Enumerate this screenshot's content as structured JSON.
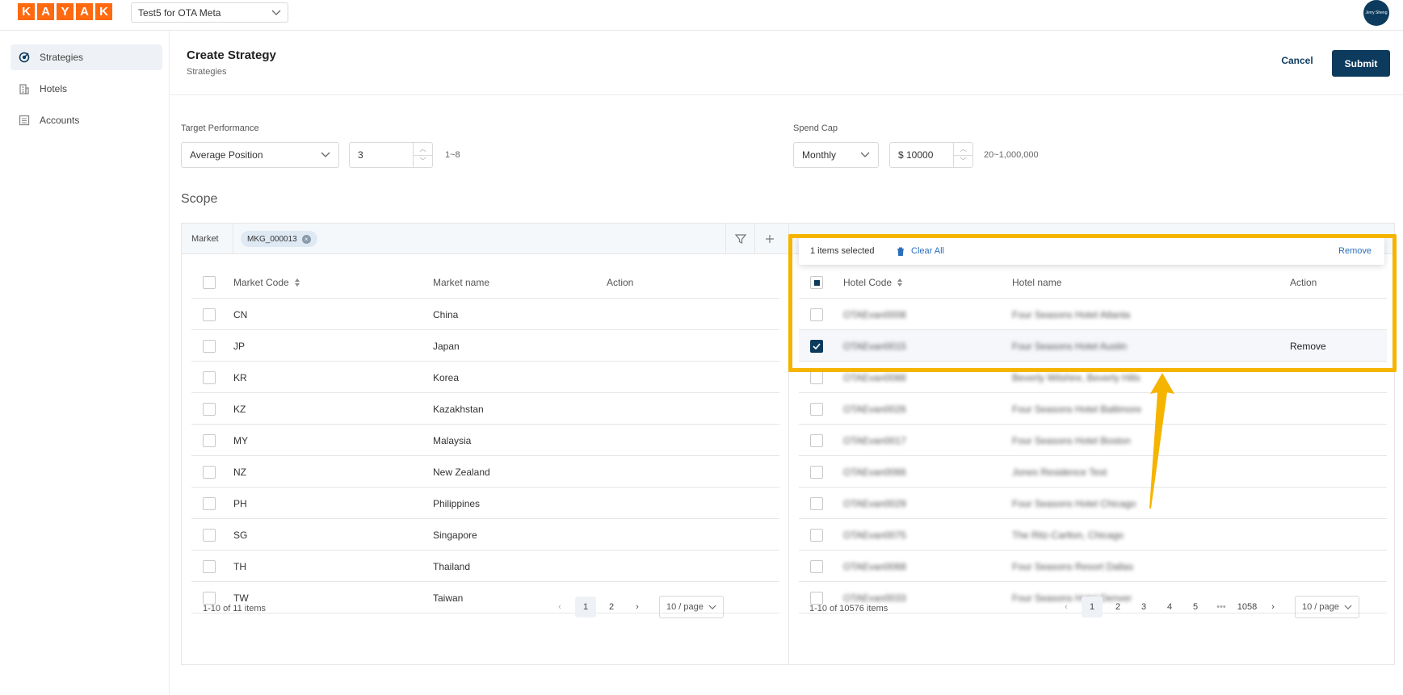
{
  "topbar": {
    "logo_letters": [
      "K",
      "A",
      "Y",
      "A",
      "K"
    ],
    "account_select": "Test5 for OTA Meta",
    "avatar_text": "Jerry Sheng"
  },
  "sidebar": {
    "items": [
      {
        "label": "Strategies",
        "icon": "target-icon",
        "active": true
      },
      {
        "label": "Hotels",
        "icon": "building-icon",
        "active": false
      },
      {
        "label": "Accounts",
        "icon": "list-icon",
        "active": false
      }
    ]
  },
  "header": {
    "title": "Create Strategy",
    "breadcrumb": "Strategies",
    "cancel_label": "Cancel",
    "submit_label": "Submit"
  },
  "form": {
    "target_label": "Target Performance",
    "target_metric": "Average Position",
    "target_value": "3",
    "target_range": "1~8",
    "spend_label": "Spend Cap",
    "spend_period": "Monthly",
    "spend_value": "$ 10000",
    "spend_range": "20~1,000,000"
  },
  "scope": {
    "title": "Scope",
    "market_label": "Market",
    "market_tag": "MKG_000013"
  },
  "market_table": {
    "headers": {
      "code": "Market Code",
      "name": "Market name",
      "action": "Action"
    },
    "rows": [
      {
        "code": "CN",
        "name": "China"
      },
      {
        "code": "JP",
        "name": "Japan"
      },
      {
        "code": "KR",
        "name": "Korea"
      },
      {
        "code": "KZ",
        "name": "Kazakhstan"
      },
      {
        "code": "MY",
        "name": "Malaysia"
      },
      {
        "code": "NZ",
        "name": "New Zealand"
      },
      {
        "code": "PH",
        "name": "Philippines"
      },
      {
        "code": "SG",
        "name": "Singapore"
      },
      {
        "code": "TH",
        "name": "Thailand"
      },
      {
        "code": "TW",
        "name": "Taiwan"
      }
    ],
    "footer": "1-10 of 11 items",
    "pages": [
      "1",
      "2"
    ],
    "page_size": "10 / page"
  },
  "hotel_table": {
    "selection": {
      "count_text": "1 items selected",
      "clear_label": "Clear All",
      "remove_label": "Remove"
    },
    "headers": {
      "code": "Hotel Code",
      "name": "Hotel name",
      "action": "Action"
    },
    "rows": [
      {
        "code": "OTAEvan0008",
        "name": "Four Seasons Hotel Atlanta",
        "action": "",
        "checked": false
      },
      {
        "code": "OTAEvan0015",
        "name": "Four Seasons Hotel Austin",
        "action": "Remove",
        "checked": true
      },
      {
        "code": "OTAEvan0088",
        "name": "Beverly Wilshire, Beverly Hills",
        "action": "",
        "checked": false
      },
      {
        "code": "OTAEvan0026",
        "name": "Four Seasons Hotel Baltimore",
        "action": "",
        "checked": false
      },
      {
        "code": "OTAEvan0017",
        "name": "Four Seasons Hotel Boston",
        "action": "",
        "checked": false
      },
      {
        "code": "OTAEvan0066",
        "name": "Jones Residence Test",
        "action": "",
        "checked": false
      },
      {
        "code": "OTAEvan0029",
        "name": "Four Seasons Hotel Chicago",
        "action": "",
        "checked": false
      },
      {
        "code": "OTAEvan0075",
        "name": "The Ritz-Carlton, Chicago",
        "action": "",
        "checked": false
      },
      {
        "code": "OTAEvan0068",
        "name": "Four Seasons Resort Dallas",
        "action": "",
        "checked": false
      },
      {
        "code": "OTAEvan0033",
        "name": "Four Seasons Hotel Denver",
        "action": "",
        "checked": false
      }
    ],
    "footer": "1-10 of 10576 items",
    "pages": [
      "1",
      "2",
      "3",
      "4",
      "5",
      "•••",
      "1058"
    ],
    "page_size": "10 / page"
  },
  "colors": {
    "brand": "#ff690f",
    "primary": "#0d3b5e",
    "highlight": "#f5b400"
  }
}
